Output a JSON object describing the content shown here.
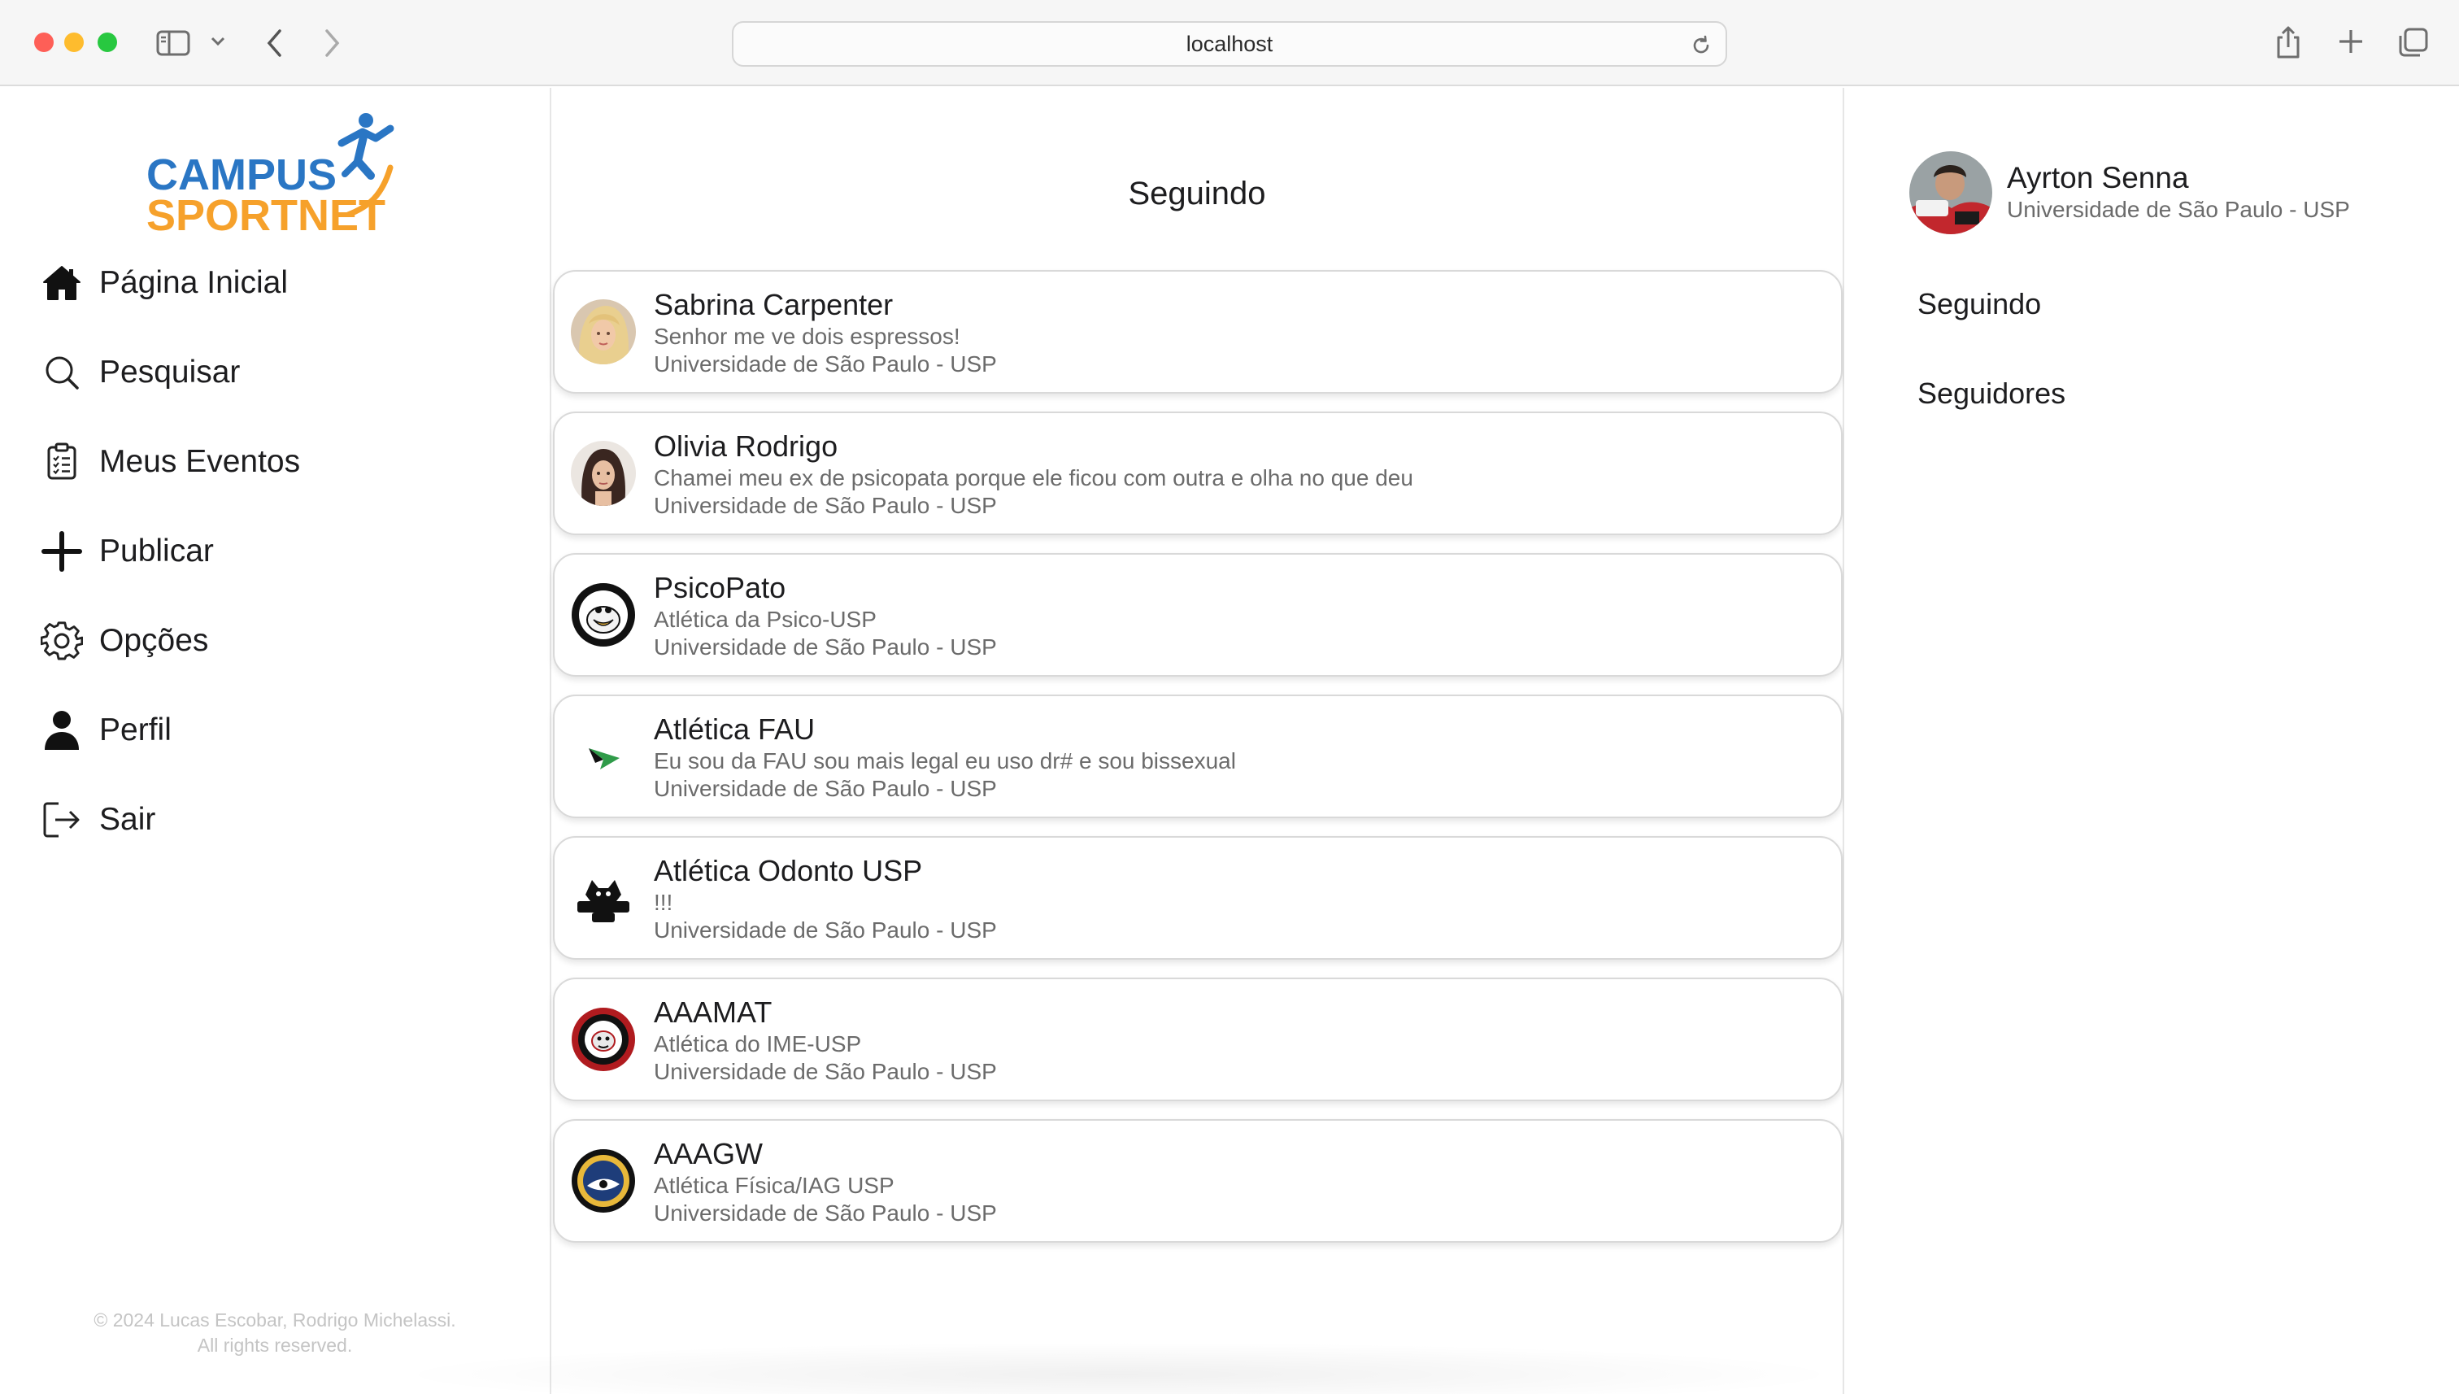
{
  "browser": {
    "address": "localhost"
  },
  "brand": {
    "line1": "CAMPUS",
    "line2": "SPORTNET",
    "blue": "#2a76c4",
    "orange": "#f6a12b"
  },
  "nav": {
    "items": [
      {
        "label": "Página Inicial",
        "icon": "home-icon"
      },
      {
        "label": "Pesquisar",
        "icon": "search-icon"
      },
      {
        "label": "Meus Eventos",
        "icon": "clipboard-list-icon"
      },
      {
        "label": "Publicar",
        "icon": "plus-icon"
      },
      {
        "label": "Opções",
        "icon": "gear-icon"
      },
      {
        "label": "Perfil",
        "icon": "person-icon"
      },
      {
        "label": "Sair",
        "icon": "logout-icon"
      }
    ]
  },
  "footer": {
    "line1": "© 2024 Lucas Escobar, Rodrigo Michelassi.",
    "line2": "All rights reserved."
  },
  "main": {
    "title": "Seguindo",
    "following": [
      {
        "name": "Sabrina Carpenter",
        "bio": "Senhor me ve dois espressos!",
        "university": "Universidade de São Paulo - USP",
        "avatar": "sabrina-avatar"
      },
      {
        "name": "Olivia Rodrigo",
        "bio": "Chamei meu ex de psicopata porque ele ficou com outra e olha no que deu",
        "university": "Universidade de São Paulo - USP",
        "avatar": "olivia-avatar"
      },
      {
        "name": "PsicoPato",
        "bio": "Atlética da Psico-USP",
        "university": "Universidade de São Paulo - USP",
        "avatar": "duck-logo-avatar"
      },
      {
        "name": "Atlética FAU",
        "bio": "Eu sou da FAU sou mais legal eu uso dr# e sou bissexual",
        "university": "Universidade de São Paulo - USP",
        "avatar": "fau-logo-avatar"
      },
      {
        "name": "Atlética Odonto USP",
        "bio": "!!!",
        "university": "Universidade de São Paulo - USP",
        "avatar": "odonto-logo-avatar"
      },
      {
        "name": "AAAMAT",
        "bio": "Atlética do IME-USP",
        "university": "Universidade de São Paulo - USP",
        "avatar": "aaamat-logo-avatar"
      },
      {
        "name": "AAAGW",
        "bio": "Atlética Física/IAG USP",
        "university": "Universidade de São Paulo - USP",
        "avatar": "aaagw-logo-avatar"
      }
    ]
  },
  "profile": {
    "name": "Ayrton Senna",
    "university": "Universidade de São Paulo - USP",
    "links": {
      "following": "Seguindo",
      "followers": "Seguidores"
    }
  }
}
